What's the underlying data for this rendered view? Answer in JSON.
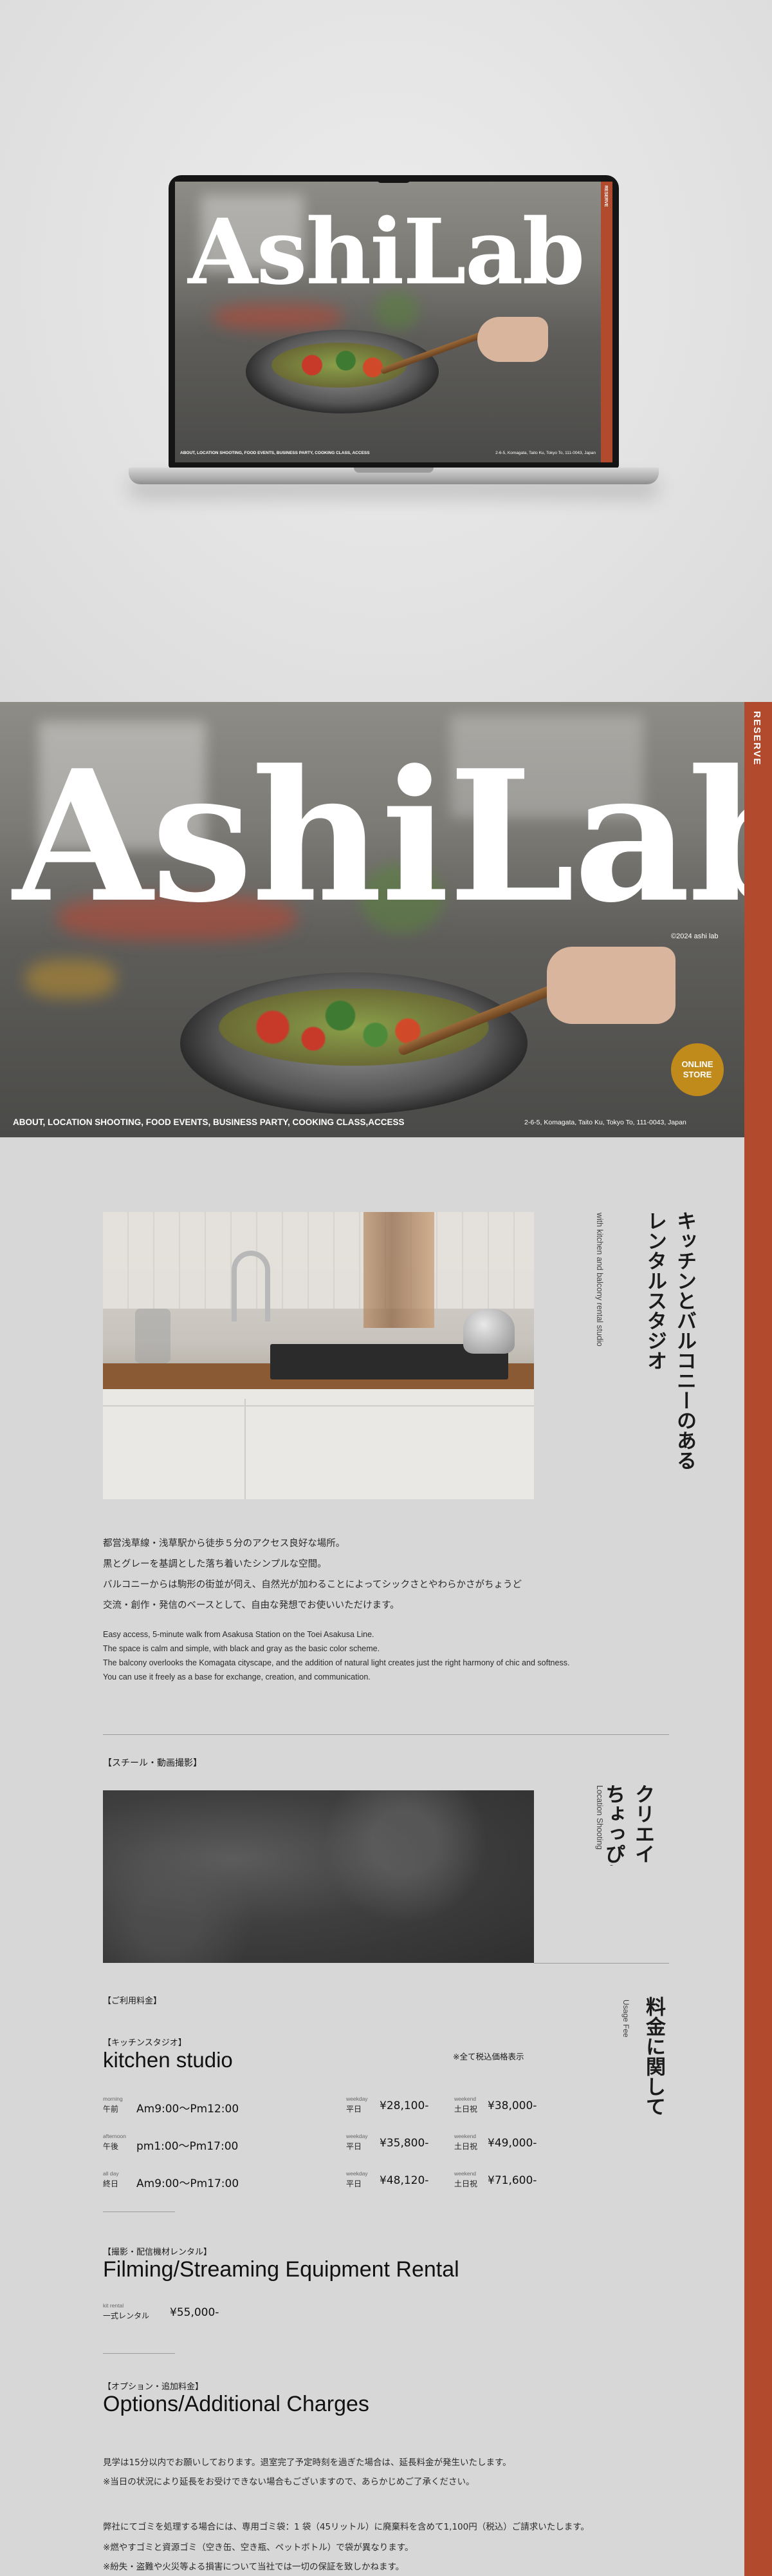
{
  "mockup": {
    "logo": "AshiLab",
    "side_label": "RESERVE",
    "nav": "ABOUT, LOCATION SHOOTING, FOOD EVENTS, BUSINESS PARTY, COOKING CLASS, ACCESS",
    "address": "2-6-5, Komagata, Taito Ku, Tokyo To, 111-0043, Japan"
  },
  "hero": {
    "logo": "AshiLab",
    "copyright": "©2024 ashi lab",
    "online_store": "ONLINE STORE",
    "nav": "ABOUT, LOCATION SHOOTING, FOOD EVENTS, BUSINESS PARTY, COOKING CLASS,ACCESS",
    "address": "2-6-5, Komagata, Taito Ku, Tokyo To, 111-0043, Japan",
    "reserve": "RESERVE"
  },
  "intro": {
    "title_line1": "キッチンとバルコニーのある",
    "title_line2": "レンタルスタジオ",
    "subtitle": "with kitchen and balcony rental studio",
    "jp_paragraphs": [
      "都営浅草線・浅草駅から徒歩５分のアクセス良好な場所。",
      "黒とグレーを基調とした落ち着いたシンプルな空間。",
      "バルコニーからは駒形の街並が伺え、自然光が加わることによってシックさとやわらかさがちょうど",
      "交流・創作・発信のベースとして、自由な発想でお使いいただけます。"
    ],
    "en_paragraphs": [
      "Easy access, 5-minute walk from Asakusa Station on the Toei Asakusa Line.",
      "The space is calm and simple, with black and gray as the basic color scheme.",
      "The balcony overlooks the Komagata cityscape, and the addition of natural light creates just the right harmony of chic and softness.",
      "You can use it freely as a base for exchange, creation, and communication."
    ]
  },
  "location": {
    "tag": "【スチール・動画撮影】",
    "title_line1": "クリエイティビテ",
    "title_line2": "ちょっぴり大人な",
    "subtitle": "Location Shooting"
  },
  "pricing": {
    "tag": "【ご利用料金】",
    "title": "料金に関して",
    "subtitle": "Usage Fee",
    "kitchen": {
      "tag": "【キッチンスタジオ】",
      "title": "kitchen studio",
      "tax_note": "※全て税込価格表示",
      "rows": [
        {
          "en": "morning",
          "jp": "午前",
          "time": "Am9:00〜Pm12:00",
          "wd_en": "weekday",
          "wd_jp": "平日",
          "wd_price": "¥28,100-",
          "we_en": "weekend",
          "we_jp": "土日祝",
          "we_price": "¥38,000-"
        },
        {
          "en": "afternoon",
          "jp": "午後",
          "time": "pm1:00〜Pm17:00",
          "wd_en": "weekday",
          "wd_jp": "平日",
          "wd_price": "¥35,800-",
          "we_en": "weekend",
          "we_jp": "土日祝",
          "we_price": "¥49,000-"
        },
        {
          "en": "all day",
          "jp": "終日",
          "time": "Am9:00〜Pm17:00",
          "wd_en": "weekday",
          "wd_jp": "平日",
          "wd_price": "¥48,120-",
          "we_en": "weekend",
          "we_jp": "土日祝",
          "we_price": "¥71,600-"
        }
      ]
    },
    "equipment": {
      "tag": "【撮影・配信機材レンタル】",
      "title": "Filming/Streaming Equipment Rental",
      "row_en": "kit rental",
      "row_jp": "一式レンタル",
      "price": "¥55,000-"
    },
    "options": {
      "tag": "【オプション・追加料金】",
      "title": "Options/Additional Charges",
      "notes": [
        "見学は15分以内でお願いしております。退室完了予定時刻を過ぎた場合は、延長料金が発生いたします。",
        "※当日の状況により延長をお受けできない場合もございますので、あらかじめご了承ください。",
        "弊社にてゴミを処理する場合には、専用ゴミ袋：1 袋（45リットル）に廃棄料を含めて1,100円（税込）ご請求いたします。",
        "※燃やすゴミと資源ゴミ（空き缶、空き瓶、ペットボトル）で袋が異なります。",
        "※紛失・盗難や火災等よる損害について当社では一切の保証を致しかねます。"
      ]
    }
  },
  "colors": {
    "accent_red": "#b24a2e",
    "accent_gold": "#c18b1b",
    "background": "#d7d7d7"
  }
}
